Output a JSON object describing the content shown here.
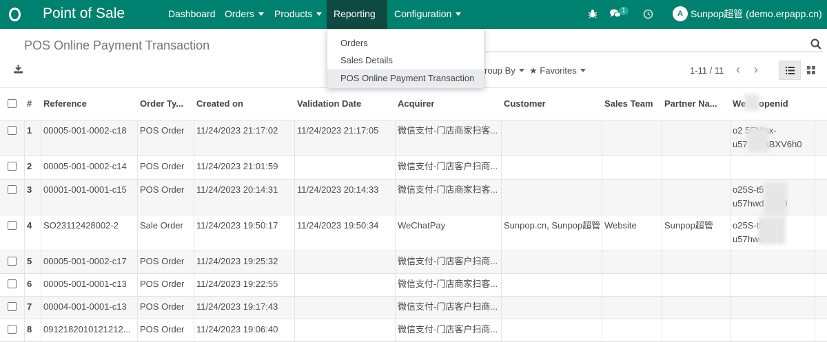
{
  "navbar": {
    "app_name": "Point of Sale",
    "menu": [
      "Dashboard",
      "Orders",
      "Products",
      "Reporting",
      "Configuration"
    ],
    "chat_badge": "1",
    "avatar_initial": "A",
    "user": "Sunpop超管 (demo.erpapp.cn)"
  },
  "dropdown": {
    "items": [
      "Orders",
      "Sales Details",
      "POS Online Payment Transaction"
    ]
  },
  "control": {
    "breadcrumb": "POS Online Payment Transaction",
    "group_by": "roup By",
    "favorites": "Favorites",
    "pager": "1-11 / 11"
  },
  "table": {
    "headers": [
      "#",
      "Reference",
      "Order Ty...",
      "Created on",
      "Validation Date",
      "Acquirer",
      "Customer",
      "Sales Team",
      "Partner Na...",
      "We   at openid"
    ],
    "rows": [
      {
        "num": "1",
        "ref": "00005-001-0002-c18",
        "type": "POS Order",
        "created": "11/24/2023 21:17:02",
        "validation": "11/24/2023 21:17:05",
        "acquirer": "微信支付-门店商家扫客...",
        "customer": "",
        "team": "",
        "partner": "",
        "openid1": "o2    5FNtsx-",
        "openid2": "u57    dzyaBXV6h0"
      },
      {
        "num": "2",
        "ref": "00005-001-0002-c14",
        "type": "POS Order",
        "created": "11/24/2023 21:01:59",
        "validation": "",
        "acquirer": "微信支付-门店客户扫商...",
        "customer": "",
        "team": "",
        "partner": "",
        "openid1": "",
        "openid2": ""
      },
      {
        "num": "3",
        "ref": "00001-001-0001-c15",
        "type": "POS Order",
        "created": "11/24/2023 20:14:31",
        "validation": "11/24/2023 20:14:33",
        "acquirer": "微信支付-门店商家扫客...",
        "customer": "",
        "team": "",
        "partner": "",
        "openid1": "o25S-t5    sx-",
        "openid2": "u57hwd    V6h0"
      },
      {
        "num": "4",
        "ref": "SO23112428002-2",
        "type": "Sale Order",
        "created": "11/24/2023 19:50:17",
        "validation": "11/24/2023 19:50:34",
        "acquirer": "WeChatPay",
        "customer": "Sunpop.cn, Sunpop超管",
        "team": "Website",
        "partner": "Sunpop超管",
        "openid1": "o25S-t5",
        "openid2": "u57hwd    6h0"
      },
      {
        "num": "5",
        "ref": "00005-001-0002-c17",
        "type": "POS Order",
        "created": "11/24/2023 19:25:32",
        "validation": "",
        "acquirer": "微信支付-门店客户扫商...",
        "customer": "",
        "team": "",
        "partner": "",
        "openid1": "",
        "openid2": ""
      },
      {
        "num": "6",
        "ref": "00005-001-0001-c13",
        "type": "POS Order",
        "created": "11/24/2023 19:22:55",
        "validation": "",
        "acquirer": "微信支付-门店商家扫客...",
        "customer": "",
        "team": "",
        "partner": "",
        "openid1": "",
        "openid2": ""
      },
      {
        "num": "7",
        "ref": "00004-001-0001-c13",
        "type": "POS Order",
        "created": "11/24/2023 19:17:43",
        "validation": "",
        "acquirer": "微信支付-门店客户扫商...",
        "customer": "",
        "team": "",
        "partner": "",
        "openid1": "",
        "openid2": ""
      },
      {
        "num": "8",
        "ref": "0912182010121212...",
        "type": "POS Order",
        "created": "11/24/2023 19:06:40",
        "validation": "",
        "acquirer": "微信支付-门店客户扫商...",
        "customer": "",
        "team": "",
        "partner": "",
        "openid1": "",
        "openid2": ""
      }
    ]
  }
}
